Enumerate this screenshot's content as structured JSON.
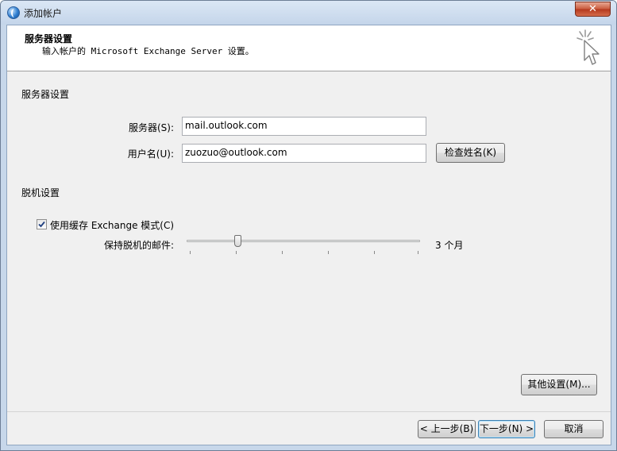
{
  "window": {
    "title": "添加帐户",
    "close_glyph": "✕"
  },
  "header": {
    "title": "服务器设置",
    "subtitle": "输入帐户的 Microsoft Exchange Server 设置。",
    "icon": "wizard-cursor-icon"
  },
  "server_section": {
    "heading": "服务器设置",
    "server_label": "服务器(S):",
    "server_value": "mail.outlook.com",
    "username_label": "用户名(U):",
    "username_value": "zuozuo@outlook.com",
    "check_name_button": "检查姓名(K)"
  },
  "offline_section": {
    "heading": "脱机设置",
    "cached_mode_label": "使用缓存 Exchange 模式(C)",
    "cached_mode_checked": true,
    "keep_offline_label": "保持脱机的邮件:",
    "keep_offline_value": "3 个月",
    "slider_position_fraction": 0.21
  },
  "more_settings_button": "其他设置(M)...",
  "footer": {
    "back_button": "< 上一步(B)",
    "next_button": "下一步(N) >",
    "cancel_button": "取消"
  },
  "colors": {
    "title_bar": "#c7d7ea",
    "close_button": "#c95a3c",
    "dialog_background": "#f0f0f0",
    "default_button_border": "#3c7fb1"
  }
}
